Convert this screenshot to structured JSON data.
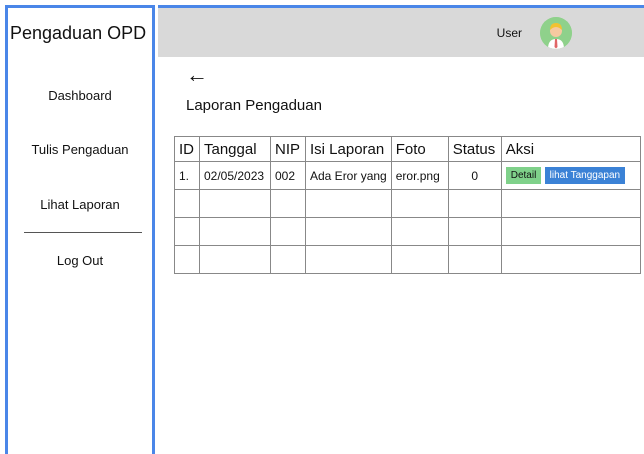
{
  "sidebar": {
    "title": "Pengaduan OPD",
    "items": [
      {
        "label": "Dashboard"
      },
      {
        "label": "Tulis Pengaduan"
      },
      {
        "label": "Lihat Laporan"
      },
      {
        "label": "Log Out"
      }
    ]
  },
  "header": {
    "user_label": "User",
    "avatar_icon": "user-avatar-icon"
  },
  "main": {
    "back_icon": "arrow-left-icon",
    "title": "Laporan Pengaduan",
    "table": {
      "headers": [
        "ID",
        "Tanggal",
        "NIP",
        "Isi Laporan",
        "Foto",
        "Status",
        "Aksi"
      ],
      "rows": [
        {
          "id": "1.",
          "tanggal": "02/05/2023",
          "nip": "002",
          "isi": "Ada Eror yang",
          "foto": "eror.png",
          "status": "0",
          "detail_label": "Detail",
          "tanggapan_label": "lihat Tanggapan"
        }
      ]
    }
  },
  "colors": {
    "accent": "#4a86e8",
    "header_bg": "#d9d9d9",
    "detail_button": "#7fd18a",
    "tanggapan_button": "#3b82d6"
  }
}
